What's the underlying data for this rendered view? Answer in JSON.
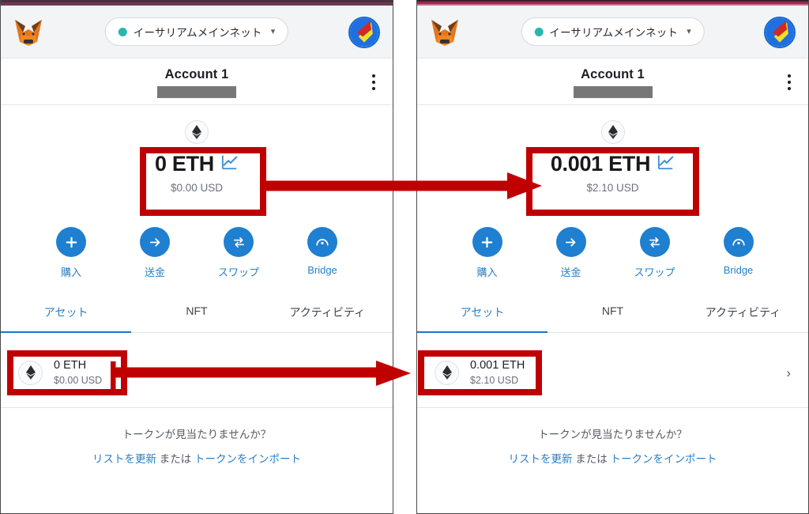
{
  "app": {
    "name": "MetaMask",
    "logo_icon": "metamask-fox-icon"
  },
  "panels": [
    {
      "id": "before",
      "network": {
        "label": "イーサリアムメインネット",
        "status_color": "#29b6af",
        "caret_icon": "chevron-down-icon"
      },
      "account": {
        "name": "Account 1",
        "address_redacted": true,
        "menu_icon": "kebab-menu-icon"
      },
      "balance": {
        "token_icon": "ethereum-icon",
        "amount": "0 ETH",
        "fiat": "$0.00 USD",
        "chart_icon": "line-chart-icon"
      },
      "actions": [
        {
          "icon": "plus-icon",
          "label": "購入"
        },
        {
          "icon": "arrow-right-icon",
          "label": "送金"
        },
        {
          "icon": "swap-arrows-icon",
          "label": "スワップ"
        },
        {
          "icon": "bridge-icon",
          "label": "Bridge"
        }
      ],
      "tabs": [
        {
          "label": "アセット",
          "active": true
        },
        {
          "label": "NFT",
          "active": false
        },
        {
          "label": "アクティビティ",
          "active": false
        }
      ],
      "token": {
        "icon": "ethereum-icon",
        "amount": "0 ETH",
        "fiat": "$0.00 USD",
        "chevron": "",
        "has_chevron": false
      },
      "footer": {
        "question": "トークンが見当たりませんか？",
        "refresh_link": "リストを更新",
        "conjunction": "または",
        "import_link": "トークンをインポート"
      }
    },
    {
      "id": "after",
      "network": {
        "label": "イーサリアムメインネット",
        "status_color": "#29b6af",
        "caret_icon": "chevron-down-icon"
      },
      "account": {
        "name": "Account 1",
        "address_redacted": true,
        "menu_icon": "kebab-menu-icon"
      },
      "balance": {
        "token_icon": "ethereum-icon",
        "amount": "0.001 ETH",
        "fiat": "$2.10 USD",
        "chart_icon": "line-chart-icon"
      },
      "actions": [
        {
          "icon": "plus-icon",
          "label": "購入"
        },
        {
          "icon": "arrow-right-icon",
          "label": "送金"
        },
        {
          "icon": "swap-arrows-icon",
          "label": "スワップ"
        },
        {
          "icon": "bridge-icon",
          "label": "Bridge"
        }
      ],
      "tabs": [
        {
          "label": "アセット",
          "active": true
        },
        {
          "label": "NFT",
          "active": false
        },
        {
          "label": "アクティビティ",
          "active": false
        }
      ],
      "token": {
        "icon": "ethereum-icon",
        "amount": "0.001 ETH",
        "fiat": "$2.10 USD",
        "chevron": "›",
        "has_chevron": true
      },
      "footer": {
        "question": "トークンが見当たりませんか？",
        "refresh_link": "リストを更新",
        "conjunction": "または",
        "import_link": "トークンをインポート"
      }
    }
  ],
  "annotations": {
    "highlight_color": "#c00000",
    "arrow_color": "#c00000",
    "boxes": [
      {
        "name": "before-balance",
        "target": "balance"
      },
      {
        "name": "after-balance",
        "target": "balance"
      },
      {
        "name": "before-token-row",
        "target": "token"
      },
      {
        "name": "after-token-row",
        "target": "token"
      }
    ],
    "arrows": [
      {
        "name": "balance-change-arrow",
        "direction": "right"
      },
      {
        "name": "token-change-arrow",
        "direction": "right"
      }
    ]
  }
}
